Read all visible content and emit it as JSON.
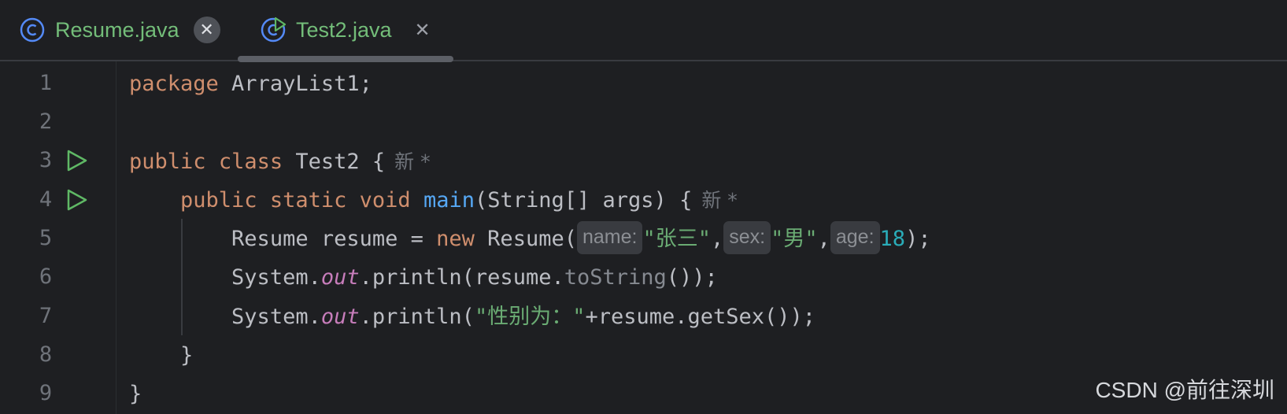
{
  "tabs": [
    {
      "label": "Resume.java",
      "icon": "class-icon",
      "close": "✕",
      "active": false
    },
    {
      "label": "Test2.java",
      "icon": "runnable-class-icon",
      "close": "✕",
      "active": true
    }
  ],
  "editor": {
    "line_numbers": [
      "1",
      "2",
      "3",
      "4",
      "5",
      "6",
      "7",
      "8",
      "9"
    ],
    "code": {
      "l1_kw": "package",
      "l1_rest": " ArrayList1;",
      "l3_kw1": "public",
      "l3_kw2": "class",
      "l3_rest": " Test2 {",
      "l3_badge": "新 *",
      "l4_kw1": "public",
      "l4_kw2": "static",
      "l4_kw3": "void",
      "l4_fn": "main",
      "l4_rest": "(String[] args) {",
      "l4_badge": "新 *",
      "l5_a": "Resume resume = ",
      "l5_kw": "new",
      "l5_b": " Resume(",
      "l5_hint_name": "name:",
      "l5_str1": "\"张三\"",
      "l5_comma1": ",",
      "l5_hint_sex": "sex:",
      "l5_str2": "\"男\"",
      "l5_comma2": ",",
      "l5_hint_age": "age:",
      "l5_num": "18",
      "l5_end": ");",
      "l6_a": "System.",
      "l6_field": "out",
      "l6_b": ".println(resume.",
      "l6_dim": "toString",
      "l6_end": "());",
      "l7_a": "System.",
      "l7_field": "out",
      "l7_b": ".println(",
      "l7_str": "\"性别为：\"",
      "l7_end": "+resume.getSex());",
      "l8": "}",
      "l9": "}"
    }
  },
  "watermark": "CSDN @前往深圳",
  "colors": {
    "background": "#1e1f22",
    "keyword": "#cf8e6d",
    "function": "#56a8f5",
    "string": "#6aab73",
    "number": "#2aacb8",
    "field": "#c77dbb",
    "text": "#bcbec4",
    "run_icon": "#5fb865"
  }
}
